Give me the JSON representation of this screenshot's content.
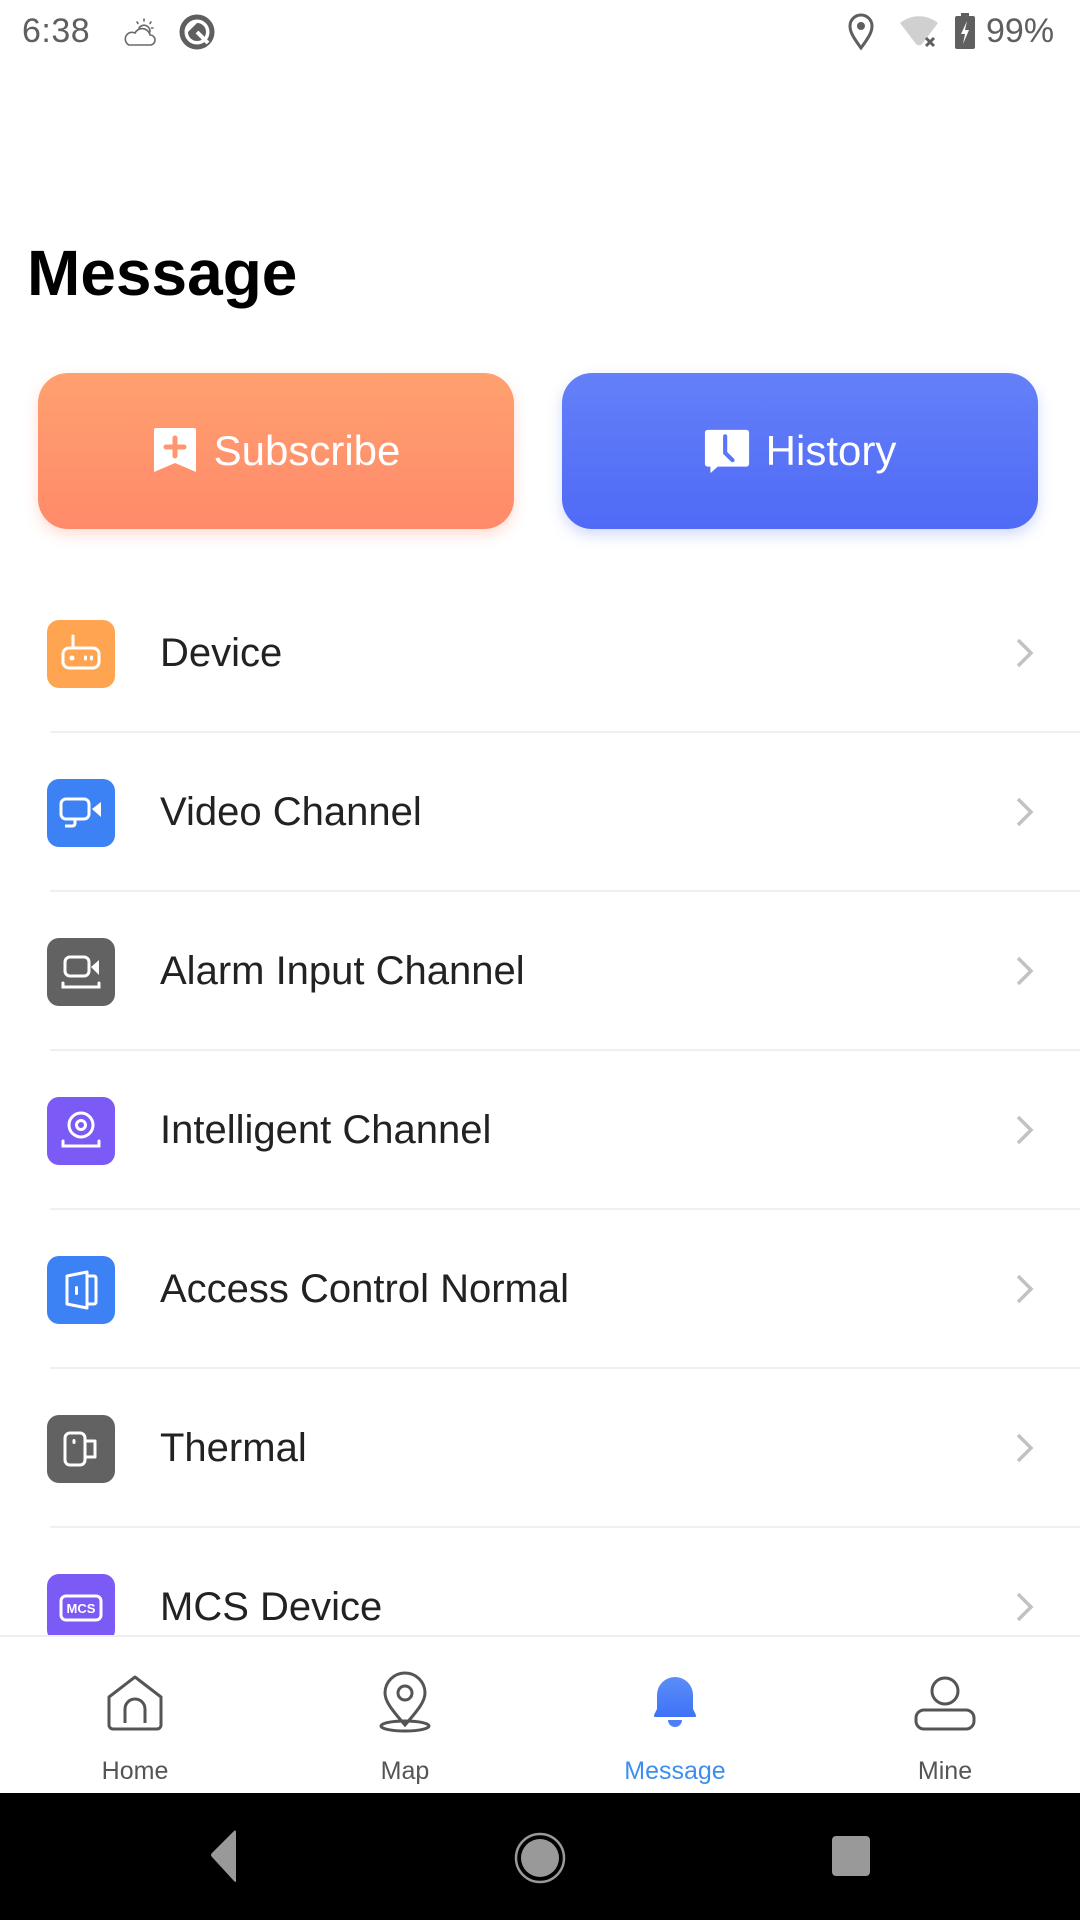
{
  "status_bar": {
    "time": "6:38",
    "battery": "99%",
    "icons": [
      "weather-partly-cloudy-icon",
      "q-logo-icon",
      "location-icon",
      "wifi-disconnected-icon",
      "battery-charging-icon"
    ]
  },
  "page": {
    "title": "Message"
  },
  "actions": {
    "subscribe": {
      "label": "Subscribe",
      "icon": "bookmark-plus-icon",
      "color_top": "#ffa06f",
      "color_bottom": "#ff8a6a"
    },
    "history": {
      "label": "History",
      "icon": "clock-chat-icon",
      "color_top": "#6480f8",
      "color_bottom": "#4f6af6"
    }
  },
  "list": {
    "items": [
      {
        "label": "Device",
        "icon": "router-icon",
        "color": "#ffa552"
      },
      {
        "label": "Video Channel",
        "icon": "camera-icon",
        "color": "#3d82f5"
      },
      {
        "label": "Alarm Input Channel",
        "icon": "alarm-camera-icon",
        "color": "#626262"
      },
      {
        "label": "Intelligent Channel",
        "icon": "webcam-icon",
        "color": "#7b5af5"
      },
      {
        "label": "Access Control Normal",
        "icon": "door-icon",
        "color": "#3d82f5"
      },
      {
        "label": "Thermal",
        "icon": "thermal-camera-icon",
        "color": "#626262"
      },
      {
        "label": "MCS Device",
        "icon": "mcs-icon",
        "color": "#7b5af5",
        "icon_text": "MCS"
      }
    ]
  },
  "tab_bar": {
    "active": "Message",
    "active_color": "#3d8ef0",
    "tabs": [
      {
        "label": "Home",
        "icon": "home-icon"
      },
      {
        "label": "Map",
        "icon": "map-pin-icon"
      },
      {
        "label": "Message",
        "icon": "bell-icon"
      },
      {
        "label": "Mine",
        "icon": "user-icon"
      }
    ]
  },
  "nav_bar": {
    "buttons": [
      "back",
      "home",
      "recents"
    ]
  }
}
